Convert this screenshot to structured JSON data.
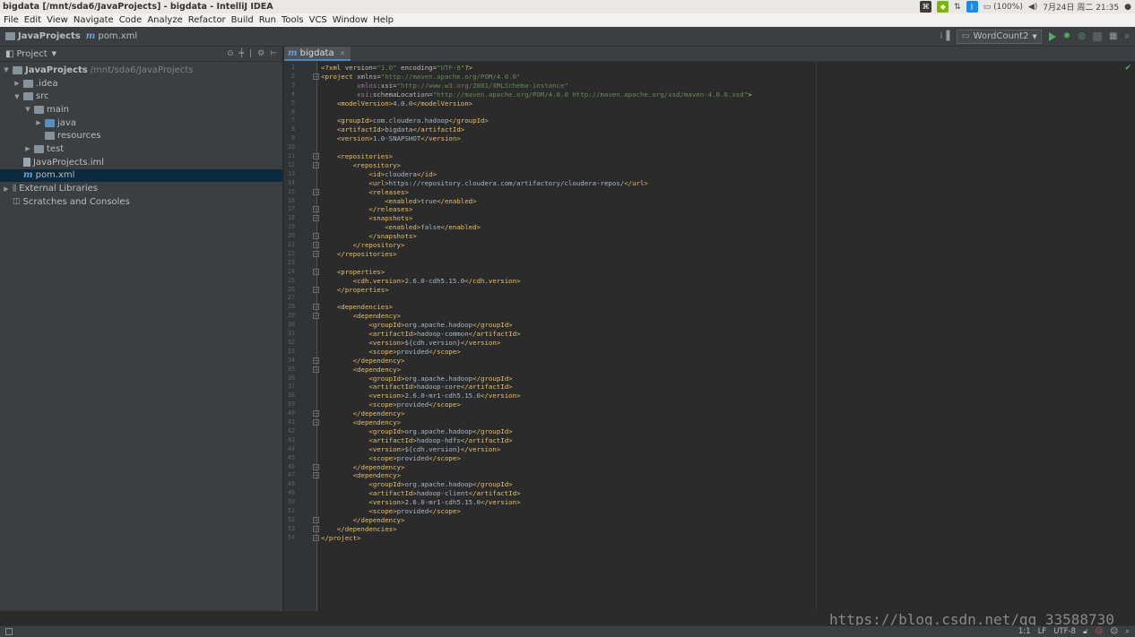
{
  "window": {
    "title": "bigdata [/mnt/sda6/JavaProjects] - bigdata - IntelliJ IDEA",
    "battery": "(100%)",
    "clock": "7月24日 周二 21:35"
  },
  "menu": [
    "File",
    "Edit",
    "View",
    "Navigate",
    "Code",
    "Analyze",
    "Refactor",
    "Build",
    "Run",
    "Tools",
    "VCS",
    "Window",
    "Help"
  ],
  "nav": {
    "project": "JavaProjects",
    "file": "pom.xml",
    "run_config": "WordCount2"
  },
  "project_panel": {
    "title": "Project",
    "tree": [
      {
        "label": "JavaProjects",
        "path": "/mnt/sda6/JavaProjects",
        "icon": "project-folder-icon",
        "arrow": "▼",
        "depth": 0,
        "bold": true
      },
      {
        "label": ".idea",
        "path": "",
        "icon": "folder-icon",
        "arrow": "▶",
        "depth": 1
      },
      {
        "label": "src",
        "path": "",
        "icon": "folder-icon",
        "arrow": "▼",
        "depth": 1
      },
      {
        "label": "main",
        "path": "",
        "icon": "folder-icon",
        "arrow": "▼",
        "depth": 2
      },
      {
        "label": "java",
        "path": "",
        "icon": "source-folder-icon",
        "arrow": "▶",
        "depth": 3
      },
      {
        "label": "resources",
        "path": "",
        "icon": "resources-folder-icon",
        "arrow": "",
        "depth": 3
      },
      {
        "label": "test",
        "path": "",
        "icon": "folder-icon",
        "arrow": "▶",
        "depth": 2
      },
      {
        "label": "JavaProjects.iml",
        "path": "",
        "icon": "iml-file-icon",
        "arrow": "",
        "depth": 1
      },
      {
        "label": "pom.xml",
        "path": "",
        "icon": "maven-icon",
        "arrow": "",
        "depth": 1,
        "selected": true
      },
      {
        "label": "External Libraries",
        "path": "",
        "icon": "library-icon",
        "arrow": "▶",
        "depth": 0
      },
      {
        "label": "Scratches and Consoles",
        "path": "",
        "icon": "scratches-icon",
        "arrow": "",
        "depth": 0
      }
    ]
  },
  "editor": {
    "tab": "bigdata",
    "lines": [
      "<?xml version=\"1.0\" encoding=\"UTF-8\"?>",
      "<project xmlns=\"http://maven.apache.org/POM/4.0.0\"",
      "         xmlns:xsi=\"http://www.w3.org/2001/XMLSchema-instance\"",
      "         xsi:schemaLocation=\"http://maven.apache.org/POM/4.0.0 http://maven.apache.org/xsd/maven-4.0.0.xsd\">",
      "    <modelVersion>4.0.0</modelVersion>",
      "",
      "    <groupId>com.cloudera.hadoop</groupId>",
      "    <artifactId>bigdata</artifactId>",
      "    <version>1.0-SNAPSHOT</version>",
      "",
      "    <repositories>",
      "        <repository>",
      "            <id>cloudera</id>",
      "            <url>https://repository.cloudera.com/artifactory/cloudera-repos/</url>",
      "            <releases>",
      "                <enabled>true</enabled>",
      "            </releases>",
      "            <snapshots>",
      "                <enabled>false</enabled>",
      "            </snapshots>",
      "        </repository>",
      "    </repositories>",
      "",
      "    <properties>",
      "        <cdh.version>2.6.0-cdh5.15.0</cdh.version>",
      "    </properties>",
      "",
      "    <dependencies>",
      "        <dependency>",
      "            <groupId>org.apache.hadoop</groupId>",
      "            <artifactId>hadoop-common</artifactId>",
      "            <version>${cdh.version}</version>",
      "            <scope>provided</scope>",
      "        </dependency>",
      "        <dependency>",
      "            <groupId>org.apache.hadoop</groupId>",
      "            <artifactId>hadoop-core</artifactId>",
      "            <version>2.6.0-mr1-cdh5.15.0</version>",
      "            <scope>provided</scope>",
      "        </dependency>",
      "        <dependency>",
      "            <groupId>org.apache.hadoop</groupId>",
      "            <artifactId>hadoop-hdfs</artifactId>",
      "            <version>${cdh.version}</version>",
      "            <scope>provided</scope>",
      "        </dependency>",
      "        <dependency>",
      "            <groupId>org.apache.hadoop</groupId>",
      "            <artifactId>hadoop-client</artifactId>",
      "            <version>2.6.0-mr1-cdh5.15.0</version>",
      "            <scope>provided</scope>",
      "        </dependency>",
      "    </dependencies>",
      "</project>"
    ],
    "fold_lines": [
      2,
      11,
      12,
      15,
      17,
      18,
      20,
      21,
      22,
      24,
      26,
      28,
      29,
      34,
      35,
      40,
      41,
      46,
      47,
      52,
      53,
      54
    ]
  },
  "status": {
    "position": "1:1",
    "line_sep": "LF",
    "encoding": "UTF-8"
  },
  "watermark": "https://blog.csdn.net/qq_33588730"
}
